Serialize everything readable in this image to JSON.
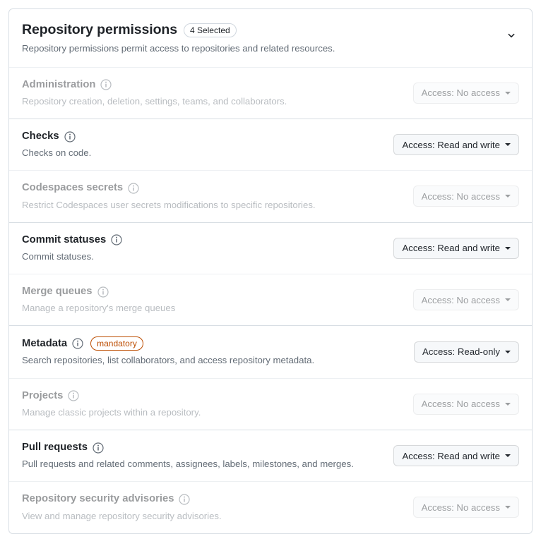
{
  "panel": {
    "title": "Repository permissions",
    "counter_badge": "4 Selected",
    "description": "Repository permissions permit access to repositories and related resources.",
    "collapse_icon": "chevron-down-icon",
    "accent_mandatory_color": "#bc4c00",
    "border_color": "#d8dee4",
    "button_bg_color": "#f6f8fa"
  },
  "access_label_prefix": "Access: ",
  "permissions": [
    {
      "name": "Administration",
      "description": "Repository creation, deletion, settings, teams, and collaborators.",
      "access": "No access",
      "access_button_label": "Access: No access",
      "mandatory": false,
      "dimmed": true,
      "info_icon": "info-icon"
    },
    {
      "name": "Checks",
      "description": "Checks on code.",
      "access": "Read and write",
      "access_button_label": "Access: Read and write",
      "mandatory": false,
      "dimmed": false,
      "info_icon": "info-icon"
    },
    {
      "name": "Codespaces secrets",
      "description": "Restrict Codespaces user secrets modifications to specific repositories.",
      "access": "No access",
      "access_button_label": "Access: No access",
      "mandatory": false,
      "dimmed": true,
      "info_icon": "info-icon"
    },
    {
      "name": "Commit statuses",
      "description": "Commit statuses.",
      "access": "Read and write",
      "access_button_label": "Access: Read and write",
      "mandatory": false,
      "dimmed": false,
      "info_icon": "info-icon"
    },
    {
      "name": "Merge queues",
      "description": "Manage a repository's merge queues",
      "access": "No access",
      "access_button_label": "Access: No access",
      "mandatory": false,
      "dimmed": true,
      "info_icon": "info-icon"
    },
    {
      "name": "Metadata",
      "description": "Search repositories, list collaborators, and access repository metadata.",
      "access": "Read-only",
      "access_button_label": "Access: Read-only",
      "mandatory": true,
      "mandatory_label": "mandatory",
      "dimmed": false,
      "info_icon": "info-icon"
    },
    {
      "name": "Projects",
      "description": "Manage classic projects within a repository.",
      "access": "No access",
      "access_button_label": "Access: No access",
      "mandatory": false,
      "dimmed": true,
      "info_icon": "info-icon"
    },
    {
      "name": "Pull requests",
      "description": "Pull requests and related comments, assignees, labels, milestones, and merges.",
      "access": "Read and write",
      "access_button_label": "Access: Read and write",
      "mandatory": false,
      "dimmed": false,
      "info_icon": "info-icon"
    },
    {
      "name": "Repository security advisories",
      "description": "View and manage repository security advisories.",
      "access": "No access",
      "access_button_label": "Access: No access",
      "mandatory": false,
      "dimmed": true,
      "info_icon": "info-icon"
    }
  ]
}
